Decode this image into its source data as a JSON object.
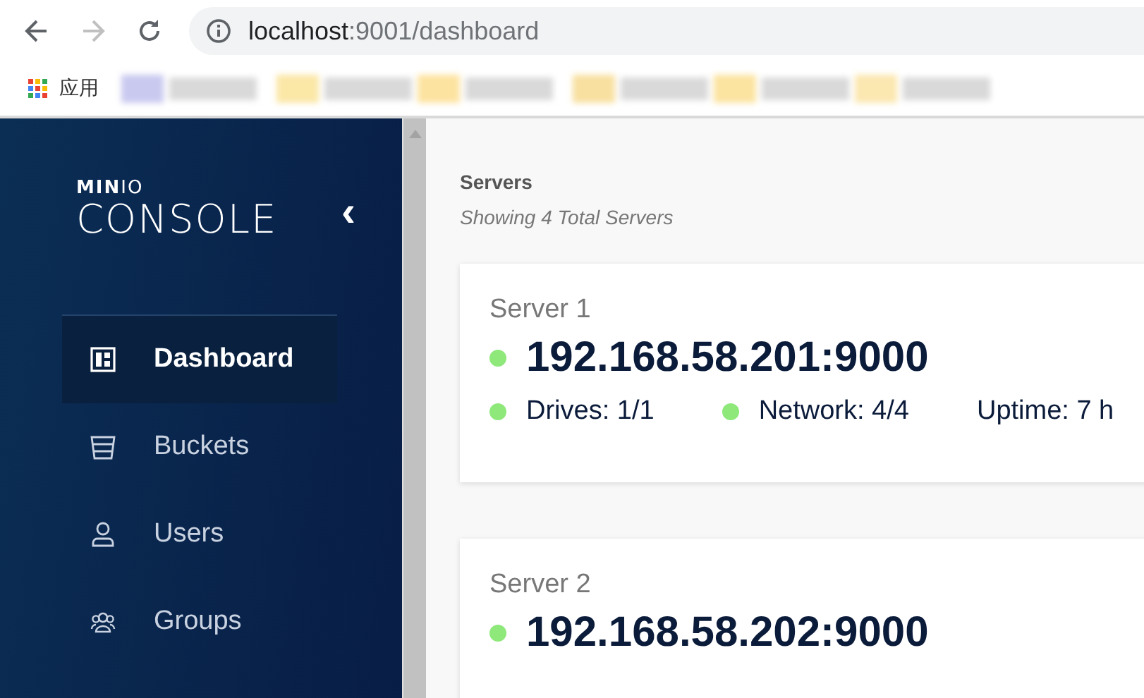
{
  "browser": {
    "back_enabled": true,
    "forward_enabled": false,
    "url_host": "localhost",
    "url_path": ":9001/dashboard",
    "bookmarks": [
      {
        "label": "应用"
      }
    ]
  },
  "sidebar": {
    "logo_top": "**MIN**IO",
    "logo_bottom": "CONSOLE",
    "collapse": "‹",
    "items": [
      {
        "label": "Dashboard",
        "selected": true
      },
      {
        "label": "Buckets",
        "selected": false
      },
      {
        "label": "Users",
        "selected": false
      },
      {
        "label": "Groups",
        "selected": false
      }
    ]
  },
  "main": {
    "title": "Servers",
    "subtitle": "Showing 4 Total Servers",
    "servers": [
      {
        "name": "Server 1",
        "address": "192.168.58.201:9000",
        "color": "#8ee87a",
        "stats": [
          {
            "text": "Drives: 1/1",
            "color": "#8ee87a"
          },
          {
            "text": "Network: 4/4",
            "color": "#8ee87a"
          },
          {
            "text": "Uptime: 7 h"
          }
        ]
      },
      {
        "name": "Server 2",
        "address": "192.168.58.202:9000",
        "color": "#8ee87a"
      }
    ]
  }
}
